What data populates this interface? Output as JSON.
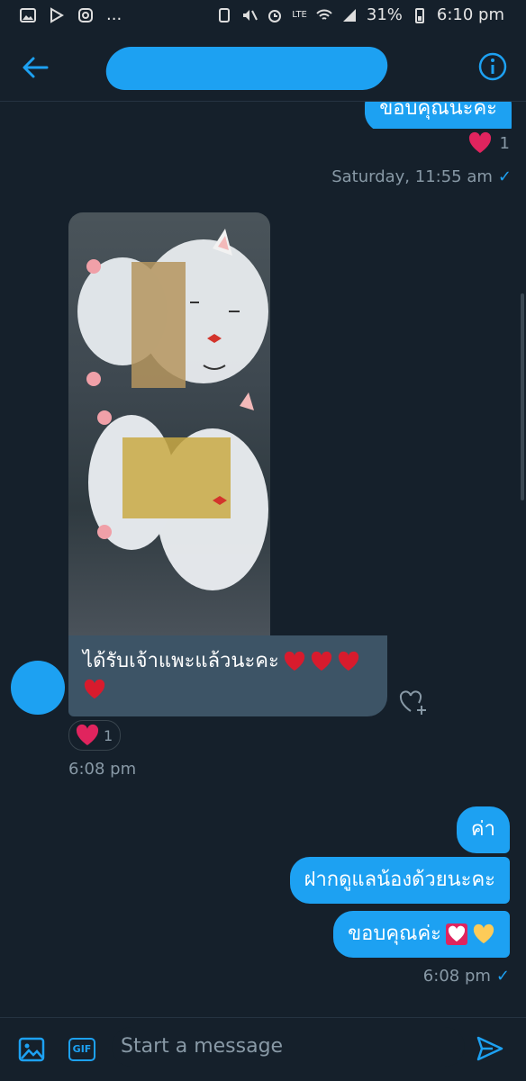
{
  "status_bar": {
    "notifications": "...",
    "battery": "31%",
    "time": "6:10 pm",
    "network": "LTE"
  },
  "header": {
    "back_icon": "back-arrow-icon",
    "info_icon": "info-icon"
  },
  "messages": {
    "top_partial_text": "ขอบคุณนะคะ",
    "top_reaction_count": "1",
    "timestamp_sat": "Saturday, 11:55 am",
    "incoming_text": "ได้รับเจ้าแพะแล้วนะคะ",
    "incoming_reaction_count": "1",
    "incoming_time": "6:08 pm",
    "out1": "ค่า",
    "out2": "ฝากดูแลน้องด้วยนะคะ",
    "out3": "ขอบคุณค่ะ",
    "out_time": "6:08 pm",
    "check": "✓"
  },
  "composer": {
    "placeholder": "Start a message",
    "gif_label": "GIF"
  },
  "colors": {
    "background": "#15202b",
    "accent": "#1da1f2",
    "incoming_bubble": "#3d5466",
    "heart": "#e0245e",
    "meta": "#8899a6"
  }
}
